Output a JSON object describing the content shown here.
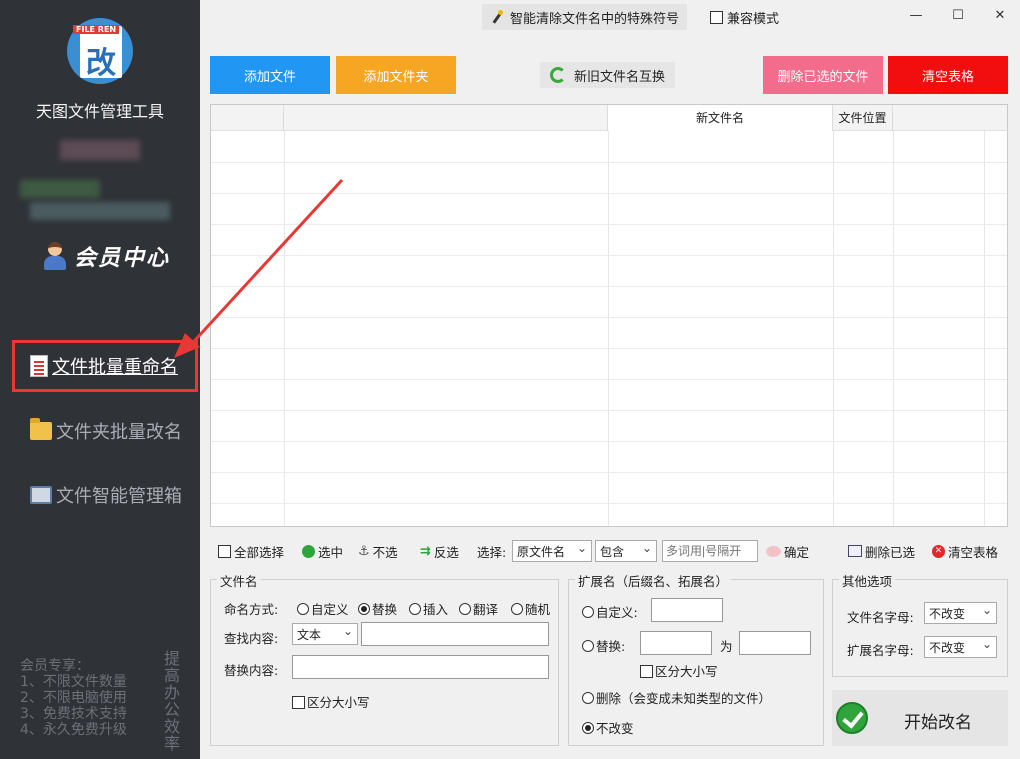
{
  "sidebar": {
    "app_title": "天图文件管理工具",
    "member_label": "会员中心",
    "nav": [
      {
        "label": "文件批量重命名",
        "icon": "document-list-icon",
        "active": true
      },
      {
        "label": "文件夹批量改名",
        "icon": "folder-icon",
        "active": false
      },
      {
        "label": "文件智能管理箱",
        "icon": "image-box-icon",
        "active": false
      }
    ],
    "promo_lines": [
      "会员专享：",
      "1、不限文件数量",
      "2、不限电脑使用",
      "3、免费技术支持",
      "4、永久免费升级"
    ],
    "promo_vertical": "提高办公效率"
  },
  "topbar": {
    "feature_label": "智能清除文件名中的特殊符号",
    "compat_label": "兼容模式",
    "min": "—",
    "max": "☐",
    "close": "✕"
  },
  "toolbar": {
    "add_file": "添加文件",
    "add_folder": "添加文件夹",
    "swap": "新旧文件名互换",
    "delete_selected": "删除已选的文件",
    "clear_table": "清空表格"
  },
  "table": {
    "columns": [
      "",
      "",
      "新文件名",
      "文件位置",
      ""
    ]
  },
  "selbar": {
    "select_all": "全部选择",
    "select": "选中",
    "unselect": "不选",
    "invert": "反选",
    "choose_label": "选择:",
    "choose_value": "原文件名",
    "match_value": "包含",
    "keyword_placeholder": "多词用|号隔开",
    "confirm": "确定",
    "delete_selected": "删除已选",
    "clear_table": "清空表格"
  },
  "filename_group": {
    "title": "文件名",
    "mode_label": "命名方式:",
    "modes": [
      "自定义",
      "替换",
      "插入",
      "翻译",
      "随机"
    ],
    "selected_mode": "替换",
    "find_label": "查找内容:",
    "find_type": "文本",
    "replace_label": "替换内容:",
    "case_label": "区分大小写"
  },
  "ext_group": {
    "title": "扩展名（后缀名、拓展名）",
    "custom": "自定义:",
    "replace": "替换:",
    "to": "为",
    "case_label": "区分大小写",
    "delete": "删除（会变成未知类型的文件）",
    "unchanged": "不改变"
  },
  "other_group": {
    "title": "其他选项",
    "filename_letters_label": "文件名字母:",
    "filename_letters_value": "不改变",
    "ext_letters_label": "扩展名字母:",
    "ext_letters_value": "不改变"
  },
  "start_button": "开始改名",
  "colors": {
    "add_file": "#2196f3",
    "add_folder": "#f6a623",
    "delete_selected": "#f36c8c",
    "clear_table": "#f20e0e",
    "highlight": "#e53935"
  }
}
